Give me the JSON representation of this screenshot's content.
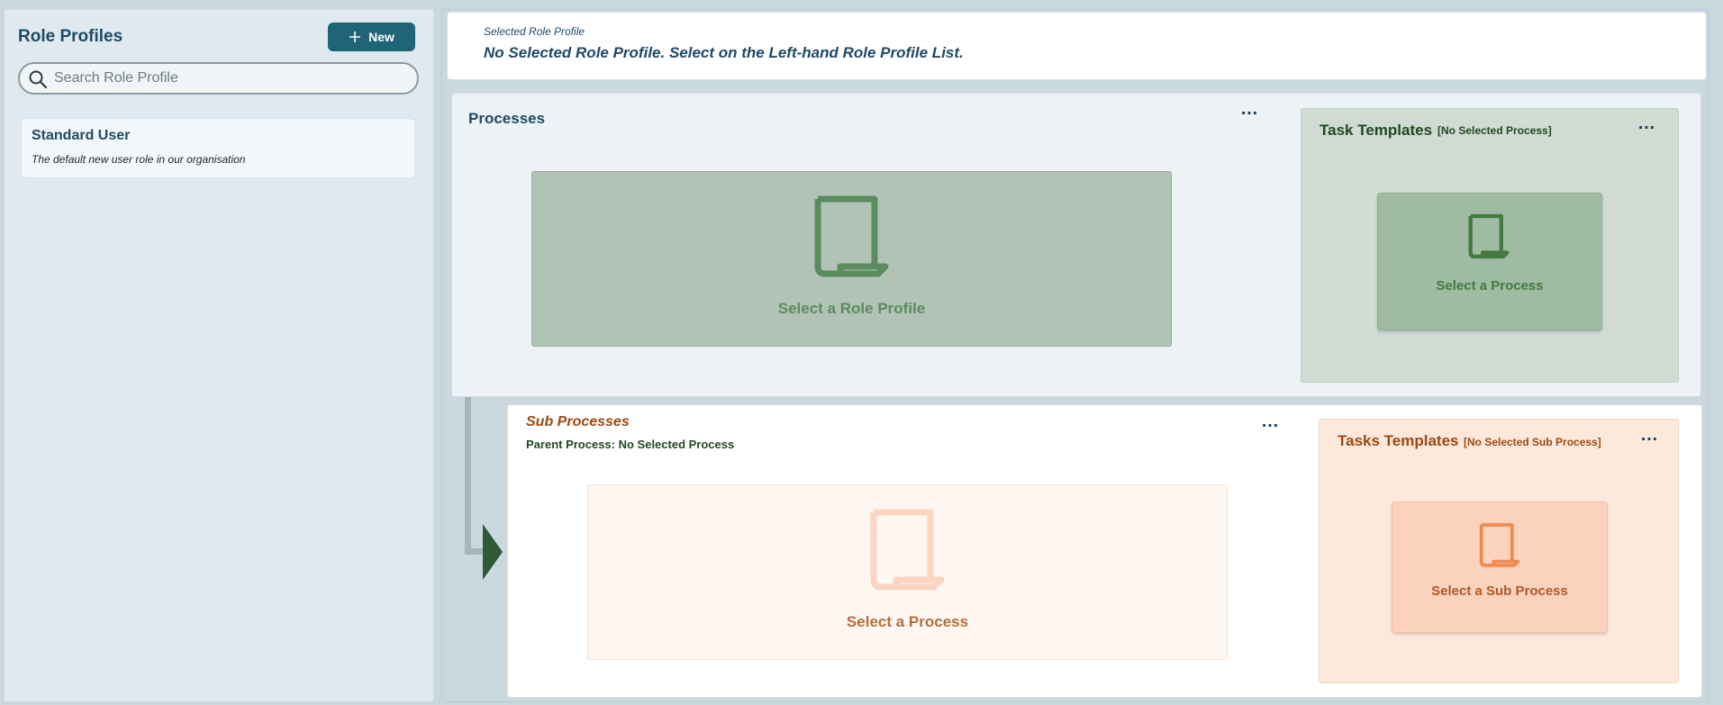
{
  "left_panel": {
    "title": "Role Profiles",
    "new_button_label": "New",
    "search": {
      "placeholder": "Search Role Profile",
      "value": ""
    },
    "profiles": [
      {
        "name": "Standard User",
        "description": "The default new user role in our organisation"
      }
    ]
  },
  "selected_role": {
    "label": "Selected Role Profile",
    "value": "No Selected Role Profile. Select on the Left-hand Role Profile List."
  },
  "processes": {
    "title": "Processes",
    "menu_label": "…",
    "empty_text": "Select a Role Profile"
  },
  "task_templates": {
    "title": "Task Templates",
    "note": "[No Selected Process]",
    "menu_label": "…",
    "empty_text": "Select a Process"
  },
  "sub_processes": {
    "title": "Sub Processes",
    "parent_label": "Parent Process: No Selected Process",
    "menu_label": "…",
    "empty_text": "Select a Process"
  },
  "sub_task_templates": {
    "title": "Tasks Templates",
    "note": "[No Selected Sub Process]",
    "menu_label": "…",
    "empty_text": "Select a Sub Process"
  },
  "icons": {
    "new": "plus-icon",
    "search": "search-icon",
    "menu": "more-horizontal-icon",
    "empty_state": "document-icon",
    "connector": "arrow-right-icon"
  },
  "colors": {
    "primary_button": "#1f6477",
    "process_green": "#5a8c5e",
    "sub_process_orange": "#b56e3e"
  }
}
